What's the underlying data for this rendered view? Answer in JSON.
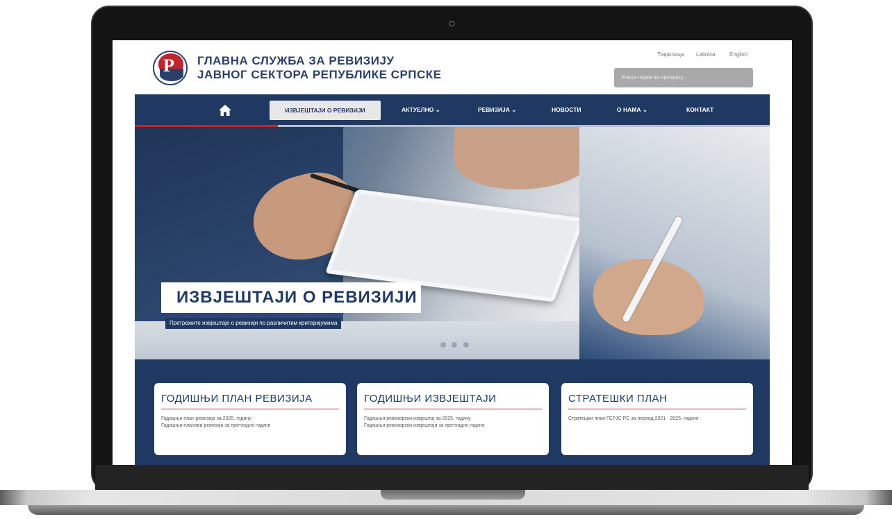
{
  "site": {
    "title_line1": "ГЛАВНА СЛУЖБА ЗА РЕВИЗИЈУ",
    "title_line2": "ЈАВНОГ СЕКТОРА РЕПУБЛИКЕ СРПСКЕ",
    "languages": [
      "Ћирилица",
      "Latinica",
      "English"
    ],
    "search_placeholder": "Унеси појам за претрагу...",
    "colors": {
      "brand_blue": "#1f3962",
      "brand_red": "#c0262d"
    }
  },
  "nav": {
    "home_icon": "home-icon",
    "items": [
      {
        "label": "ИЗВЈЕШТАЈИ О РЕВИЗИЈИ",
        "active": true
      },
      {
        "label": "АКТУЕЛНО ⌄"
      },
      {
        "label": "РЕВИЗИЈА ⌄"
      },
      {
        "label": "НОВОСТИ"
      },
      {
        "label": "О НАМА ⌄"
      },
      {
        "label": "КОНТАКТ"
      }
    ]
  },
  "hero": {
    "title": "ИЗВЈЕШТАЈИ О РЕВИЗИЈИ",
    "subtitle": "Претражите извјештаје о ревизији по различитим критеријумима"
  },
  "cards": [
    {
      "title": "ГОДИШЊИ ПЛАН РЕВИЗИЈА",
      "lines": [
        "Годишњи план ревизија за 2025. годину",
        "Годишњи планови ревизија за претходне године"
      ]
    },
    {
      "title": "ГОДИШЊИ ИЗВЈЕШТАЈИ",
      "lines": [
        "Годишњи ревизорски извјештај за 2025. годину",
        "Годишњи ревизорски извјештаји за претходне године"
      ]
    },
    {
      "title": "СТРАТЕШКИ ПЛАН",
      "lines": [
        "Стратешки план ГСРЈС РС за период 2021 - 2025. године"
      ]
    }
  ]
}
